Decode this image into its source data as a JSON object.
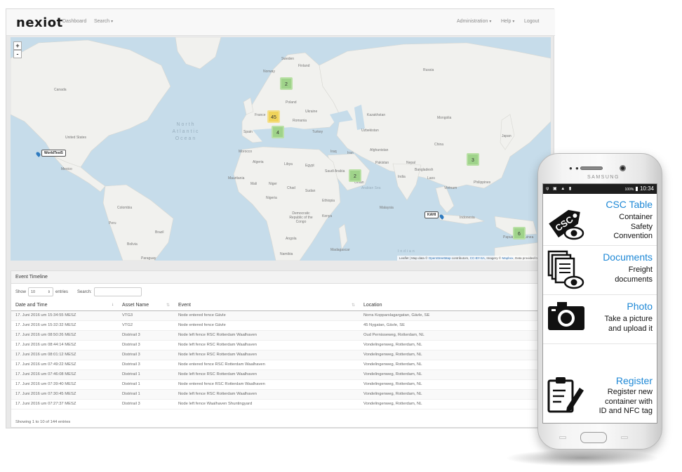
{
  "navbar": {
    "logo": "nexiot",
    "dashboard": "Dashboard",
    "search": "Search",
    "administration": "Administration",
    "help": "Help",
    "logout": "Logout"
  },
  "map": {
    "zoom_in": "+",
    "zoom_out": "-",
    "clusters": [
      {
        "id": "scandinavia",
        "count": "2",
        "color": "green"
      },
      {
        "id": "central-europe",
        "count": "45",
        "color": "yellow"
      },
      {
        "id": "mediterranean",
        "count": "4",
        "color": "green"
      },
      {
        "id": "arabia",
        "count": "2",
        "color": "green"
      },
      {
        "id": "china",
        "count": "3",
        "color": "green"
      },
      {
        "id": "new-guinea",
        "count": "6",
        "color": "green"
      }
    ],
    "markers": [
      "WorldTest5",
      "KAHI"
    ],
    "ocean_labels": {
      "atlantic_1": "North",
      "atlantic_2": "Atlantic",
      "atlantic_3": "Ocean",
      "arabian": "Arabian Sea",
      "indian": "Indian"
    },
    "place_labels": {
      "canada": "Canada",
      "united_states": "United States",
      "mexico": "Mexico",
      "colombia": "Colombia",
      "peru": "Peru",
      "bolivia": "Bolivia",
      "brazil": "Brazil",
      "paraguay": "Paraguay",
      "sweden": "Sweden",
      "norway": "Norway",
      "finland": "Finland",
      "russia": "Russia",
      "poland": "Poland",
      "ukraine": "Ukraine",
      "kazakhstan": "Kazakhstan",
      "mongolia": "Mongolia",
      "france": "France",
      "spain": "Spain",
      "romania": "Romania",
      "turkey": "Turkey",
      "uzbekistan": "Uzbekistan",
      "china": "China",
      "morocco": "Morocco",
      "algeria": "Algeria",
      "libya": "Libya",
      "egypt": "Egypt",
      "iraq": "Iraq",
      "iran": "Iran",
      "afghanistan": "Afghanistan",
      "pakistan": "Pakistan",
      "nepal": "Nepal",
      "india": "India",
      "bangladesh": "Bangladesh",
      "saudi_arabia": "Saudi Arabia",
      "oman": "Oman",
      "mauritania": "Mauritania",
      "mali": "Mali",
      "niger": "Niger",
      "chad": "Chad",
      "sudan": "Sudan",
      "ethiopia": "Ethiopia",
      "nigeria": "Nigeria",
      "kenya": "Kenya",
      "drc": "Democratic Republic of the Congo",
      "angola": "Angola",
      "namibia": "Namibia",
      "madagascar": "Madagascar",
      "japan": "Japan",
      "laos": "Laos",
      "vietnam": "Vietnam",
      "malaysia": "Malaysia",
      "indonesia": "Indonesia",
      "papua": "Papua New Guinea",
      "philippines": "Philippines"
    },
    "attribution": {
      "prefix": "Leaflet | Map data © ",
      "osm": "OpenStreetMap",
      "mid": " contributors, ",
      "cc": "CC-BY-SA",
      "imagery": ", Imagery © ",
      "mapbox": "Mapbox",
      "tail": ", Data provided by Nexiot"
    }
  },
  "timeline": {
    "heading": "Event Timeline",
    "show_label": "Show",
    "entries_value": "10",
    "entries_label": "entries",
    "search_label": "Search:",
    "search_value": "",
    "columns": [
      "Date and Time",
      "Asset Name",
      "Event",
      "Location"
    ],
    "rows": [
      [
        "17. Juni 2016 um 15:34:55 MESZ",
        "VTG3",
        "Node entered fence Gävle",
        "Norra Kopparslagargatan, Gävle, SE"
      ],
      [
        "17. Juni 2016 um 15:32:32 MESZ",
        "VTG2",
        "Node entered fence Gävle",
        "45 Nygatan, Gävle, SE"
      ],
      [
        "17. Juni 2016 um 08:50:26 MESZ",
        "Distrirail 3",
        "Node left fence RSC Rotterdam Waalhaven",
        "Oud Pernisseweg, Rotterdam, NL"
      ],
      [
        "17. Juni 2016 um 08:44:14 MESZ",
        "Distrirail 3",
        "Node left fence RSC Rotterdam Waalhaven",
        "Vondelingenweg, Rotterdam, NL"
      ],
      [
        "17. Juni 2016 um 08:01:12 MESZ",
        "Distrirail 3",
        "Node left fence RSC Rotterdam Waalhaven",
        "Vondelingenweg, Rotterdam, NL"
      ],
      [
        "17. Juni 2016 um 07:49:22 MESZ",
        "Distrirail 3",
        "Node entered fence RSC Rotterdam Waalhaven",
        "Vondelingenweg, Rotterdam, NL"
      ],
      [
        "17. Juni 2016 um 07:46:08 MESZ",
        "Distrirail 1",
        "Node left fence RSC Rotterdam Waalhaven",
        "Vondelingenweg, Rotterdam, NL"
      ],
      [
        "17. Juni 2016 um 07:39:40 MESZ",
        "Distrirail 1",
        "Node entered fence RSC Rotterdam Waalhaven",
        "Vondelingenweg, Rotterdam, NL"
      ],
      [
        "17. Juni 2016 um 07:30:45 MESZ",
        "Distrirail 1",
        "Node left fence RSC Rotterdam Waalhaven",
        "Vondelingenweg, Rotterdam, NL"
      ],
      [
        "17. Juni 2016 um 07:27:37 MESZ",
        "Distrirail 3",
        "Node left fence Waalhaven Shuntingyard",
        "Vondelingenweg, Rotterdam, NL"
      ]
    ],
    "footer": "Showing 1 to 10 of 144 entries"
  },
  "phone": {
    "brand": "SAMSUNG",
    "status_battery": "100%",
    "status_time": "10:34",
    "menu": [
      {
        "title": "CSC Table",
        "desc": [
          "Container",
          "Safety",
          "Convention"
        ],
        "icon": "csc-tag-eye-icon"
      },
      {
        "title": "Documents",
        "desc": [
          "Freight",
          "documents"
        ],
        "icon": "documents-eye-icon"
      },
      {
        "title": "Photo",
        "desc": [
          "Take a picture",
          "and upload it"
        ],
        "icon": "camera-icon"
      },
      {
        "title": "Register",
        "desc": [
          "Register new",
          "container with",
          "ID and NFC tag"
        ],
        "icon": "clipboard-pen-icon"
      }
    ],
    "icon_text_csc": "CSC"
  },
  "colors": {
    "accent_blue": "#1e88d6",
    "cluster_green": "#9fd38a",
    "cluster_yellow": "#f0d35a",
    "water": "#c6dcea",
    "land": "#f2f2f0"
  }
}
